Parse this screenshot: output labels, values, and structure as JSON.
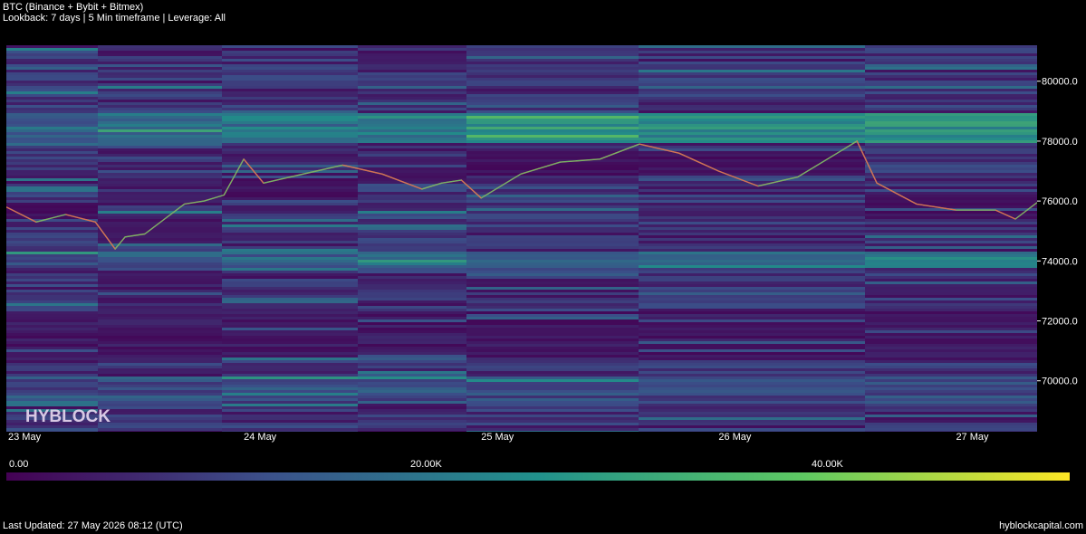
{
  "header": {
    "title": "BTC (Binance + Bybit + Bitmex)",
    "subtitle": "Lookback: 7 days | 5 Min timeframe | Leverage: All"
  },
  "footer": {
    "last_updated": "Last Updated: 27 May 2026 08:12 (UTC)",
    "site": "hyblockcapital.com"
  },
  "watermark": "HYBLOCK",
  "chart_data": {
    "type": "heatmap",
    "y_axis": {
      "range": [
        68300,
        81200
      ],
      "ticks": [
        70000,
        72000,
        74000,
        76000,
        78000,
        80000
      ],
      "tick_labels": [
        "70000.0",
        "72000.0",
        "74000.0",
        "76000.0",
        "78000.0",
        "80000.0"
      ]
    },
    "x_axis": {
      "range": [
        "2026-05-23",
        "2026-05-27T08:12"
      ],
      "tick_labels": [
        "23 May",
        "24 May",
        "25 May",
        "26 May",
        "27 May"
      ],
      "tick_dates": [
        "2026-05-23",
        "2026-05-24",
        "2026-05-25",
        "2026-05-26",
        "2026-05-27"
      ]
    },
    "colorbar": {
      "range": [
        0,
        53000
      ],
      "tick_values": [
        0,
        20000,
        40000
      ],
      "tick_labels": [
        "0.00",
        "20.00K",
        "40.00K"
      ],
      "colors": [
        "#440154",
        "#3b528b",
        "#21918c",
        "#5ec962",
        "#fde725"
      ]
    },
    "price_series": {
      "x": [
        "2026-05-23T00:00",
        "2026-05-23T03:00",
        "2026-05-23T06:00",
        "2026-05-23T09:00",
        "2026-05-23T11:00",
        "2026-05-23T12:00",
        "2026-05-23T14:00",
        "2026-05-23T16:00",
        "2026-05-23T18:00",
        "2026-05-23T20:00",
        "2026-05-23T22:00",
        "2026-05-24T00:00",
        "2026-05-24T02:00",
        "2026-05-24T06:00",
        "2026-05-24T10:00",
        "2026-05-24T14:00",
        "2026-05-24T18:00",
        "2026-05-24T20:00",
        "2026-05-24T22:00",
        "2026-05-25T00:00",
        "2026-05-25T04:00",
        "2026-05-25T08:00",
        "2026-05-25T12:00",
        "2026-05-25T16:00",
        "2026-05-25T20:00",
        "2026-05-26T00:00",
        "2026-05-26T04:00",
        "2026-05-26T08:00",
        "2026-05-26T12:00",
        "2026-05-26T14:00",
        "2026-05-26T16:00",
        "2026-05-26T20:00",
        "2026-05-27T00:00",
        "2026-05-27T04:00",
        "2026-05-27T06:00",
        "2026-05-27T08:12"
      ],
      "y": [
        75800,
        75300,
        75550,
        75300,
        74400,
        74800,
        74900,
        75400,
        75900,
        76000,
        76200,
        77400,
        76600,
        76900,
        77200,
        76900,
        76400,
        76600,
        76700,
        76100,
        76900,
        77300,
        77400,
        77900,
        77600,
        77000,
        76500,
        76800,
        77600,
        78000,
        76600,
        75900,
        75700,
        75700,
        75400,
        75950
      ]
    }
  }
}
